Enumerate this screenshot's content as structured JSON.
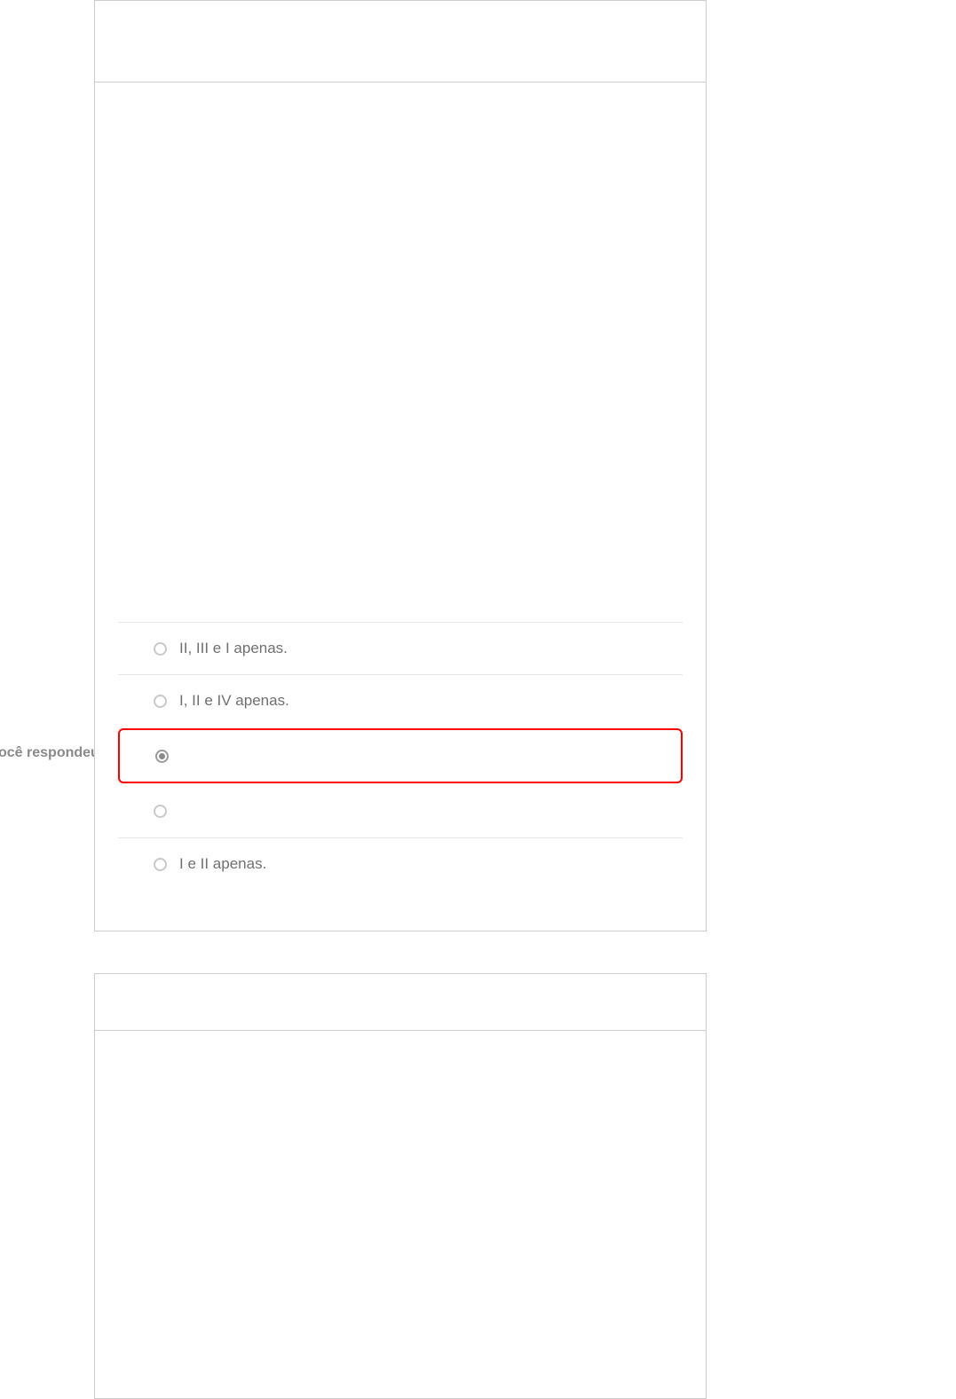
{
  "side_label": "ocê respondeu",
  "question1": {
    "options": [
      {
        "label": "II, III e I apenas.",
        "checked": false,
        "highlight": false
      },
      {
        "label": "I, II e IV apenas.",
        "checked": false,
        "highlight": false
      },
      {
        "label": "",
        "checked": true,
        "highlight": true
      },
      {
        "label": "",
        "checked": false,
        "highlight": false
      },
      {
        "label": "I e II apenas.",
        "checked": false,
        "highlight": false
      }
    ]
  }
}
